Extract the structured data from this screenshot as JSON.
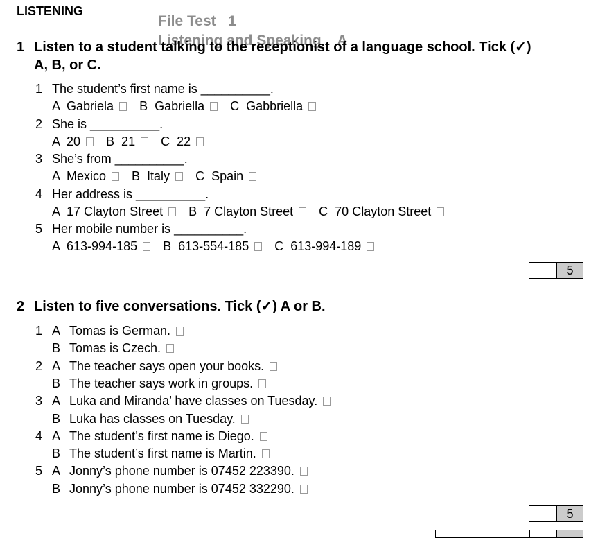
{
  "page": {
    "section_title": "LISTENING",
    "header": {
      "line1": "File Test   1",
      "line2": "Listening and Speaking    A"
    }
  },
  "task1": {
    "number": "1",
    "instruction_line1": "Listen to a student talking to the receptionist of a language school. Tick (✓)",
    "instruction_line2": "A, B, or C.",
    "questions": [
      {
        "num": "1",
        "text": "The student’s first name is __________.",
        "options": [
          "A  Gabriela",
          "B  Gabriella",
          "C  Gabbriella"
        ]
      },
      {
        "num": "2",
        "text": "She is __________.",
        "options": [
          "A  20",
          "B  21",
          "C  22"
        ]
      },
      {
        "num": "3",
        "text": "She’s from __________.",
        "options": [
          "A  Mexico",
          "B  Italy",
          "C  Spain"
        ]
      },
      {
        "num": "4",
        "text": "Her address is __________.",
        "options": [
          "A  17 Clayton Street",
          "B  7 Clayton Street",
          "C  70 Clayton Street"
        ]
      },
      {
        "num": "5",
        "text": "Her mobile number is __________.",
        "options": [
          "A  613-994-185",
          "B  613-554-185",
          "C  613-994-189"
        ]
      }
    ],
    "score_max": "5"
  },
  "task2": {
    "number": "2",
    "instruction": "Listen to five conversations. Tick (✓) A or B.",
    "questions": [
      {
        "num": "1",
        "a": "Tomas is German.",
        "b": "Tomas is Czech."
      },
      {
        "num": "2",
        "a": "The teacher says open your books.",
        "b": "The teacher says work in groups."
      },
      {
        "num": "3",
        "a": "Luka and Miranda’ have classes on Tuesday.",
        "b": "Luka has classes on Tuesday."
      },
      {
        "num": "4",
        "a": "The student’s first name is Diego.",
        "b": "The student’s first name is Martin."
      },
      {
        "num": "5",
        "a": "Jonny’s phone number is 07452 223390.",
        "b": "Jonny’s phone number is 07452 332290."
      }
    ],
    "letters": [
      "A",
      "B"
    ],
    "score_max": "5"
  }
}
